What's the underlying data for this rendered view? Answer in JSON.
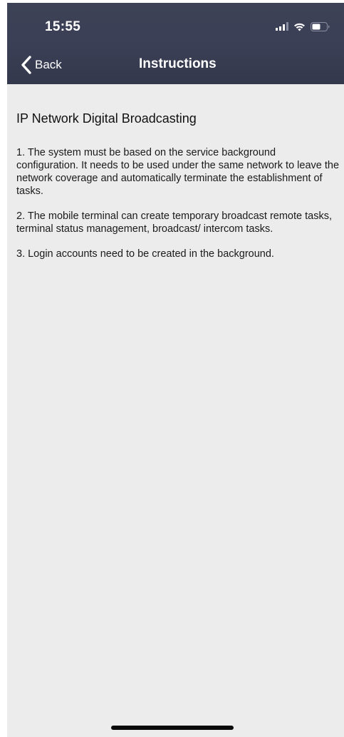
{
  "status_bar": {
    "time": "15:55",
    "icons": [
      "cellular-signal-icon",
      "wifi-icon",
      "battery-icon"
    ]
  },
  "nav_bar": {
    "back_label": "Back",
    "title": "Instructions",
    "back_icon": "chevron-left-icon"
  },
  "content": {
    "title": "IP Network Digital Broadcasting",
    "paragraphs": [
      "1. The system must be based on the service background configuration. It needs to be used under the same network to leave the network coverage and automatically terminate the establishment of tasks.",
      "2. The mobile terminal can create temporary broadcast remote tasks, terminal status management, broadcast/ intercom tasks.",
      "3. Login accounts need to be created in the background."
    ]
  },
  "colors": {
    "header_background": "#3a3f55",
    "content_background": "#ececec",
    "header_text": "#ffffff",
    "body_text": "#1a1a1a"
  }
}
